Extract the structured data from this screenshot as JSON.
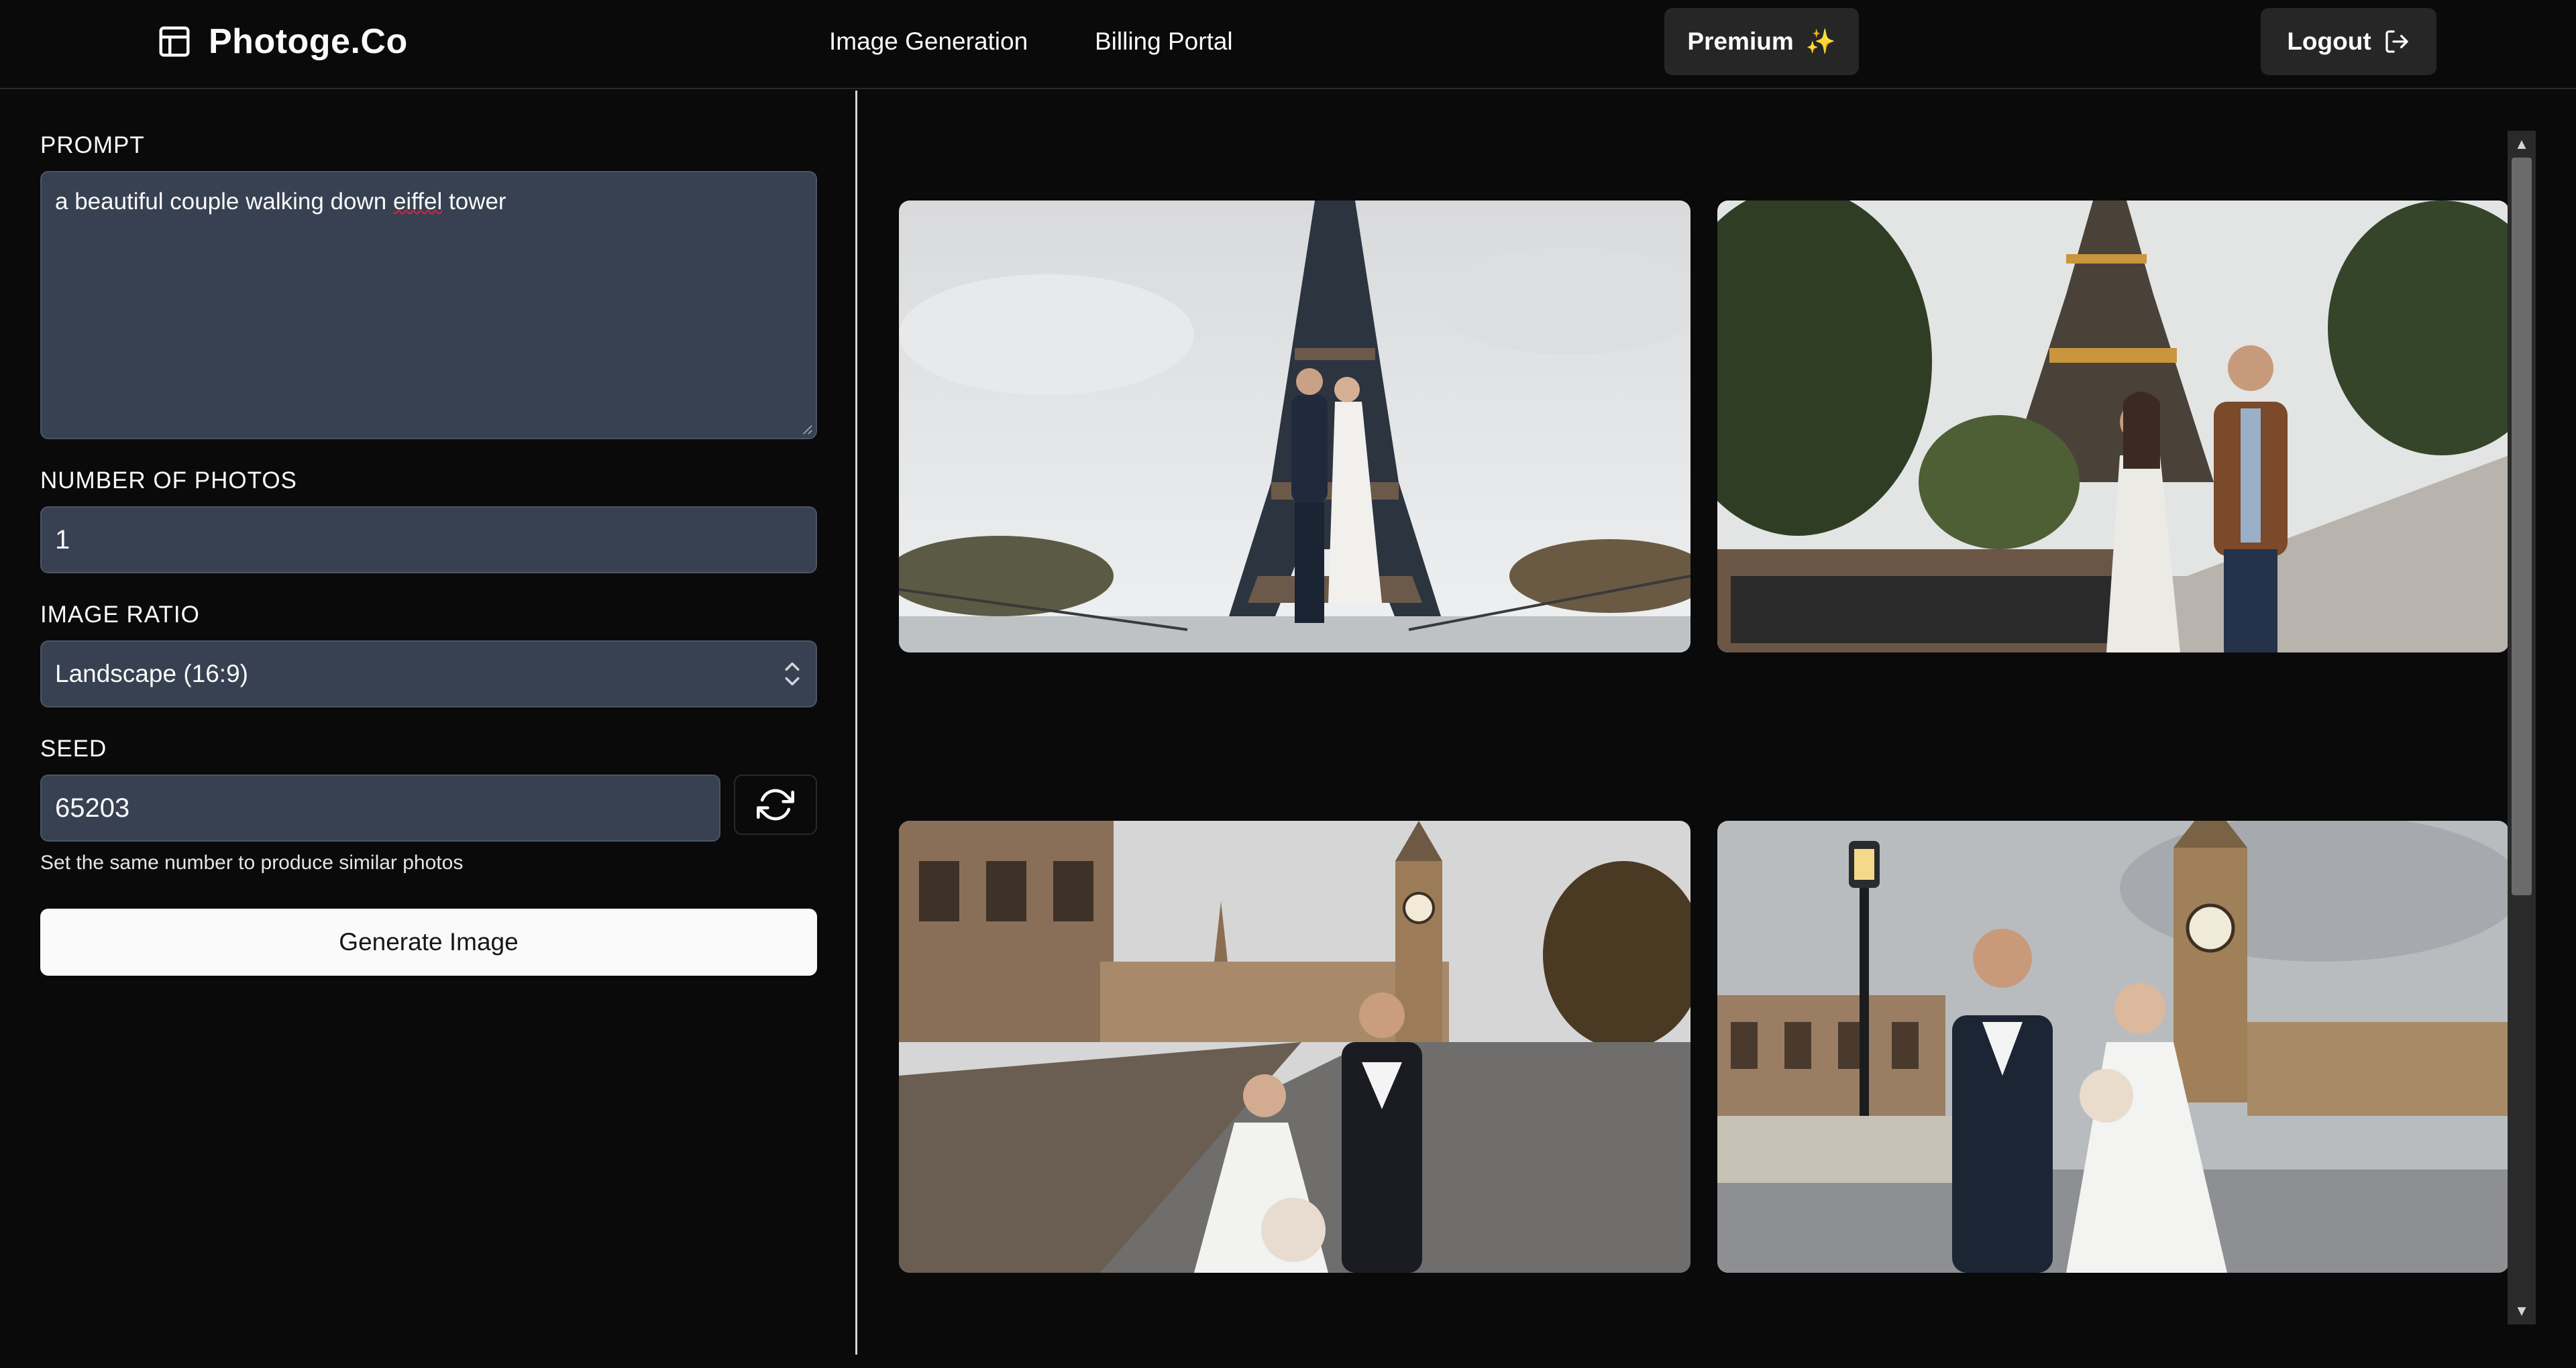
{
  "header": {
    "brand": "Photoge.Co",
    "nav": {
      "image_generation": "Image Generation",
      "billing_portal": "Billing Portal"
    },
    "premium_label": "Premium",
    "premium_icon": "sparkles-icon",
    "logout_label": "Logout",
    "logout_icon": "logout-icon"
  },
  "form": {
    "prompt_label": "PROMPT",
    "prompt_text_before": "a beautiful couple walking down ",
    "prompt_text_spell": "eiffel",
    "prompt_text_after": " tower",
    "number_label": "NUMBER OF PHOTOS",
    "number_value": "1",
    "ratio_label": "IMAGE RATIO",
    "ratio_value": "Landscape (16:9)",
    "seed_label": "SEED",
    "seed_value": "65203",
    "seed_help": "Set the same number to produce similar photos",
    "generate_label": "Generate Image"
  },
  "gallery": {
    "images": [
      {
        "scene": "couple-eiffel-tower-1"
      },
      {
        "scene": "couple-eiffel-tower-2"
      },
      {
        "scene": "wedding-couple-big-ben-1"
      },
      {
        "scene": "wedding-couple-big-ben-2"
      }
    ]
  },
  "colors": {
    "background": "#0a0a0a",
    "field": "#374151",
    "button_dark": "#262626",
    "button_light": "#fafafa",
    "accent_sparkle": "#f5c542"
  }
}
